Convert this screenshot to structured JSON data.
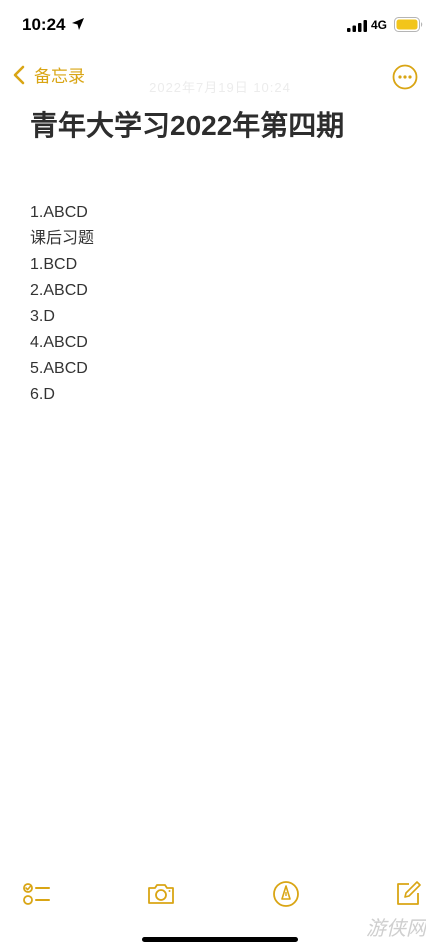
{
  "status": {
    "time": "10:24",
    "network": "4G",
    "battery_color": "#f2c51a"
  },
  "nav": {
    "back_label": "备忘录",
    "accent_color": "#d9a514",
    "date_ghost": "2022年7月19日 10:24"
  },
  "note": {
    "title": "青年大学习2022年第四期",
    "lines": [
      "1.ABCD",
      "课后习题",
      "1.BCD",
      "2.ABCD",
      "3.D",
      "4.ABCD",
      "5.ABCD",
      "6.D"
    ]
  },
  "toolbar": {
    "icons": [
      "checklist-icon",
      "camera-icon",
      "markup-icon",
      "compose-icon"
    ]
  },
  "watermark": {
    "text": "游侠网"
  }
}
